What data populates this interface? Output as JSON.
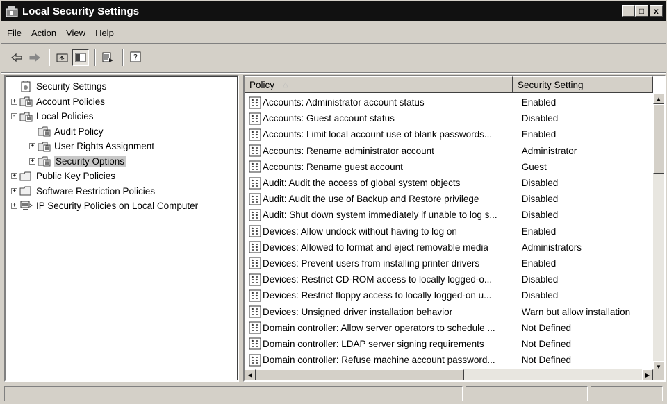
{
  "window": {
    "title": "Local Security Settings",
    "minimize": "_",
    "maximize": "□",
    "close": "x"
  },
  "menu": [
    {
      "label": "File",
      "u": "F"
    },
    {
      "label": "Action",
      "u": "A"
    },
    {
      "label": "View",
      "u": "V"
    },
    {
      "label": "Help",
      "u": "H"
    }
  ],
  "toolbar": [
    "back-icon",
    "forward-icon",
    "up-folder-icon",
    "show-hide-tree-icon",
    "export-list-icon",
    "help-icon"
  ],
  "tree": [
    {
      "label": "Security Settings",
      "level": 0,
      "expander": "",
      "icon": "security-settings-icon"
    },
    {
      "label": "Account Policies",
      "level": 0,
      "expander": "+",
      "icon": "folder-lock-icon"
    },
    {
      "label": "Local Policies",
      "level": 0,
      "expander": "-",
      "icon": "folder-lock-icon"
    },
    {
      "label": "Audit Policy",
      "level": 1,
      "expander": "",
      "icon": "folder-lock-icon"
    },
    {
      "label": "User Rights Assignment",
      "level": 1,
      "expander": "+",
      "icon": "folder-lock-icon"
    },
    {
      "label": "Security Options",
      "level": 1,
      "expander": "+",
      "icon": "folder-lock-icon",
      "selected": true
    },
    {
      "label": "Public Key Policies",
      "level": 0,
      "expander": "+",
      "icon": "folder-icon"
    },
    {
      "label": "Software Restriction Policies",
      "level": 0,
      "expander": "+",
      "icon": "folder-icon"
    },
    {
      "label": "IP Security Policies on Local Computer",
      "level": 0,
      "expander": "+",
      "icon": "ip-security-icon"
    }
  ],
  "list": {
    "columns": {
      "policy": "Policy",
      "setting": "Security Setting"
    },
    "rows": [
      {
        "policy": "Accounts: Administrator account status",
        "setting": "Enabled"
      },
      {
        "policy": "Accounts: Guest account status",
        "setting": "Disabled"
      },
      {
        "policy": "Accounts: Limit local account use of blank passwords...",
        "setting": "Enabled"
      },
      {
        "policy": "Accounts: Rename administrator account",
        "setting": "Administrator"
      },
      {
        "policy": "Accounts: Rename guest account",
        "setting": "Guest"
      },
      {
        "policy": "Audit: Audit the access of global system objects",
        "setting": "Disabled"
      },
      {
        "policy": "Audit: Audit the use of Backup and Restore privilege",
        "setting": "Disabled"
      },
      {
        "policy": "Audit: Shut down system immediately if unable to log s...",
        "setting": "Disabled"
      },
      {
        "policy": "Devices: Allow undock without having to log on",
        "setting": "Enabled"
      },
      {
        "policy": "Devices: Allowed to format and eject removable media",
        "setting": "Administrators"
      },
      {
        "policy": "Devices: Prevent users from installing printer drivers",
        "setting": "Enabled"
      },
      {
        "policy": "Devices: Restrict CD-ROM access to locally logged-o...",
        "setting": "Disabled"
      },
      {
        "policy": "Devices: Restrict floppy access to locally logged-on u...",
        "setting": "Disabled"
      },
      {
        "policy": "Devices: Unsigned driver installation behavior",
        "setting": "Warn but allow installation"
      },
      {
        "policy": "Domain controller: Allow server operators to schedule ...",
        "setting": "Not Defined"
      },
      {
        "policy": "Domain controller: LDAP server signing requirements",
        "setting": "Not Defined"
      },
      {
        "policy": "Domain controller: Refuse machine account password...",
        "setting": "Not Defined"
      }
    ]
  }
}
